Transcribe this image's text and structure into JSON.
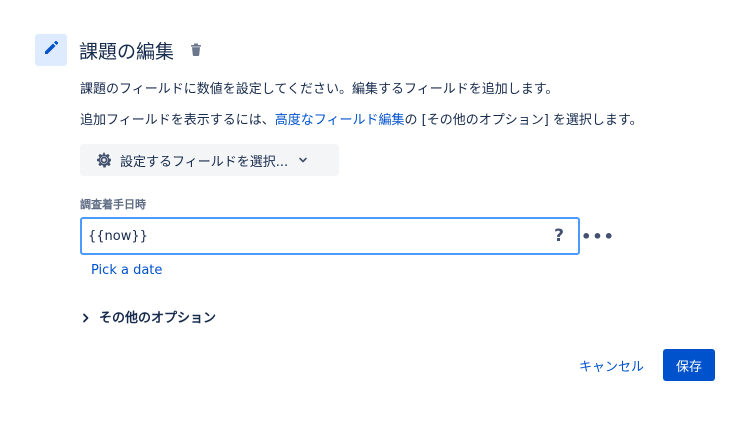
{
  "header": {
    "icon": "pencil-icon",
    "title": "課題の編集",
    "delete_icon": "trash-icon"
  },
  "description": {
    "line1": "課題のフィールドに数値を設定してください。編集するフィールドを追加します。",
    "line2_prefix": "追加フィールドを表示するには、",
    "line2_link": "高度なフィールド編集",
    "line2_suffix": "の [その他のオプション] を選択します。"
  },
  "field_picker": {
    "icon": "gear-icon",
    "label": "設定するフィールドを選択...",
    "chevron": "chevron-down-icon"
  },
  "field": {
    "label": "調査着手日時",
    "value": "{{now}}",
    "help_label": "?",
    "more_label": "•••",
    "pick_date": "Pick a date"
  },
  "more_options": {
    "label": "その他のオプション",
    "icon": "chevron-right-icon"
  },
  "actions": {
    "cancel": "キャンセル",
    "save": "保存"
  },
  "colors": {
    "accent": "#0052cc",
    "focus_border": "#4c9aff",
    "icon_bg": "#deebff",
    "picker_bg": "#f4f5f7"
  }
}
